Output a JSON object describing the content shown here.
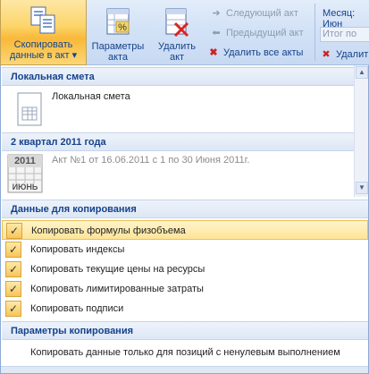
{
  "ribbon": {
    "copy_button_label": "Скопировать данные в акт",
    "copy_button_line1": "Скопировать",
    "copy_button_line2": "данные в акт ▾",
    "params_button_line1": "Параметры",
    "params_button_line2": "акта",
    "delete_button_line1": "Удалить",
    "delete_button_line2": "акт",
    "next_act": "Следующий акт",
    "prev_act": "Предыдущий акт",
    "delete_all": "Удалить все акты",
    "month_label": "Месяц: Июн",
    "itog_label": "Итог по",
    "delete_right": "Удалит"
  },
  "panel": {
    "section_local": "Локальная смета",
    "local_item": "Локальная смета",
    "section_quarter": "2 квартал 2011 года",
    "calendar_year": "2011",
    "calendar_month": "ИЮНЬ",
    "act_item": "Акт №1 от 16.06.2011 с 1 по 30 Июня 2011г.",
    "section_data": "Данные для копирования",
    "options": [
      "Копировать формулы физобъема",
      "Копировать индексы",
      "Копировать текущие цены на ресурсы",
      "Копировать лимитированные затраты",
      "Копировать подписи"
    ],
    "checkmark": "✓",
    "section_params": "Параметры копирования",
    "param_item": "Копировать данные только для позиций с ненулевым выполнением"
  },
  "icons": {
    "copy": "copy-icon",
    "params": "percent-document-icon",
    "delete": "delete-document-icon",
    "next": "arrow-right-icon",
    "prev": "arrow-left-icon",
    "delete_all": "delete-all-icon",
    "spreadsheet": "spreadsheet-icon",
    "calendar": "calendar-icon"
  }
}
